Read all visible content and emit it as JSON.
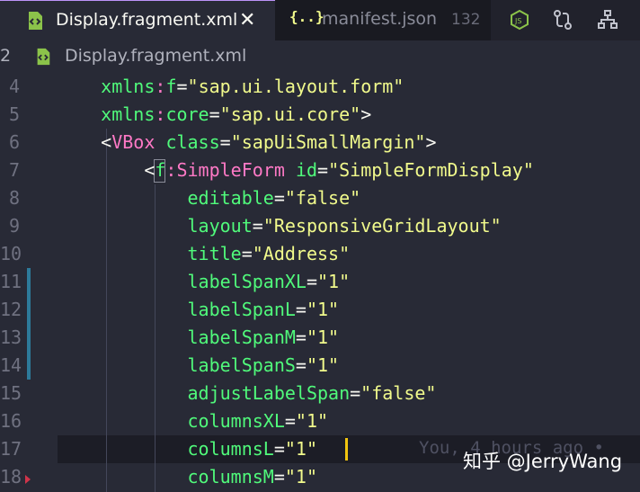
{
  "tabs": [
    {
      "label": "Display.fragment.xml",
      "active": true,
      "close_glyph": "✕",
      "icon": "xml-file-icon"
    },
    {
      "label": "manifest.json",
      "badge": "132",
      "icon": "json-file-icon",
      "icon_glyph": "{..}"
    }
  ],
  "breadcrumb": {
    "prefix": "2",
    "file": "Display.fragment.xml"
  },
  "editor": {
    "lines": [
      {
        "num": "4",
        "indent": "    ",
        "tokens": [
          [
            "attr",
            "xmlns"
          ],
          [
            "ns",
            ":"
          ],
          [
            "attr",
            "f"
          ],
          [
            "punc",
            "="
          ],
          [
            "str",
            "\"sap.ui.layout.form\""
          ]
        ]
      },
      {
        "num": "5",
        "indent": "    ",
        "tokens": [
          [
            "attr",
            "xmlns"
          ],
          [
            "ns",
            ":"
          ],
          [
            "attr",
            "core"
          ],
          [
            "punc",
            "="
          ],
          [
            "str",
            "\"sap.ui.core\""
          ],
          [
            "punc",
            ">"
          ]
        ]
      },
      {
        "num": "6",
        "indent": "    ",
        "tokens": [
          [
            "punc",
            "<"
          ],
          [
            "tag",
            "VBox"
          ],
          [
            "punc",
            " "
          ],
          [
            "attr",
            "class"
          ],
          [
            "punc",
            "="
          ],
          [
            "str",
            "\"sapUiSmallMargin\""
          ],
          [
            "punc",
            ">"
          ]
        ]
      },
      {
        "num": "7",
        "indent": "        ",
        "tokens": [
          [
            "punc",
            "<"
          ],
          [
            "attr",
            "f"
          ],
          [
            "ns",
            ":"
          ],
          [
            "tag",
            "SimpleForm"
          ],
          [
            "punc",
            " "
          ],
          [
            "attr",
            "id"
          ],
          [
            "punc",
            "="
          ],
          [
            "str",
            "\"SimpleFormDisplay\""
          ]
        ]
      },
      {
        "num": "8",
        "indent": "            ",
        "tokens": [
          [
            "attr",
            "editable"
          ],
          [
            "punc",
            "="
          ],
          [
            "str",
            "\"false\""
          ]
        ]
      },
      {
        "num": "9",
        "indent": "            ",
        "tokens": [
          [
            "attr",
            "layout"
          ],
          [
            "punc",
            "="
          ],
          [
            "str",
            "\"ResponsiveGridLayout\""
          ]
        ]
      },
      {
        "num": "10",
        "indent": "            ",
        "tokens": [
          [
            "attr",
            "title"
          ],
          [
            "punc",
            "="
          ],
          [
            "str",
            "\"Address\""
          ]
        ]
      },
      {
        "num": "11",
        "indent": "            ",
        "tokens": [
          [
            "attr",
            "labelSpanXL"
          ],
          [
            "punc",
            "="
          ],
          [
            "str",
            "\"1\""
          ]
        ]
      },
      {
        "num": "12",
        "indent": "            ",
        "tokens": [
          [
            "attr",
            "labelSpanL"
          ],
          [
            "punc",
            "="
          ],
          [
            "str",
            "\"1\""
          ]
        ]
      },
      {
        "num": "13",
        "indent": "            ",
        "tokens": [
          [
            "attr",
            "labelSpanM"
          ],
          [
            "punc",
            "="
          ],
          [
            "str",
            "\"1\""
          ]
        ]
      },
      {
        "num": "14",
        "indent": "            ",
        "tokens": [
          [
            "attr",
            "labelSpanS"
          ],
          [
            "punc",
            "="
          ],
          [
            "str",
            "\"1\""
          ]
        ]
      },
      {
        "num": "15",
        "indent": "            ",
        "tokens": [
          [
            "attr",
            "adjustLabelSpan"
          ],
          [
            "punc",
            "="
          ],
          [
            "str",
            "\"false\""
          ]
        ]
      },
      {
        "num": "16",
        "indent": "            ",
        "tokens": [
          [
            "attr",
            "columnsXL"
          ],
          [
            "punc",
            "="
          ],
          [
            "str",
            "\"1\""
          ]
        ]
      },
      {
        "num": "17",
        "indent": "            ",
        "tokens": [
          [
            "attr",
            "columnsL"
          ],
          [
            "punc",
            "="
          ],
          [
            "str",
            "\"1\""
          ]
        ]
      },
      {
        "num": "18",
        "indent": "            ",
        "tokens": [
          [
            "attr",
            "columnsM"
          ],
          [
            "punc",
            "="
          ],
          [
            "str",
            "\"1\""
          ]
        ]
      }
    ],
    "blame": "You, 4 hours ago •",
    "watermark": "知乎 @JerryWang"
  },
  "colors": {
    "attribute": "#50fa7b",
    "string": "#f1fa8c",
    "tag": "#ff79c6",
    "git_modified": "#2d7a9a",
    "cursor": "#f1c40f"
  },
  "toolbar_icons": [
    "node-js-icon",
    "compare-changes-icon",
    "open-changes-icon"
  ]
}
